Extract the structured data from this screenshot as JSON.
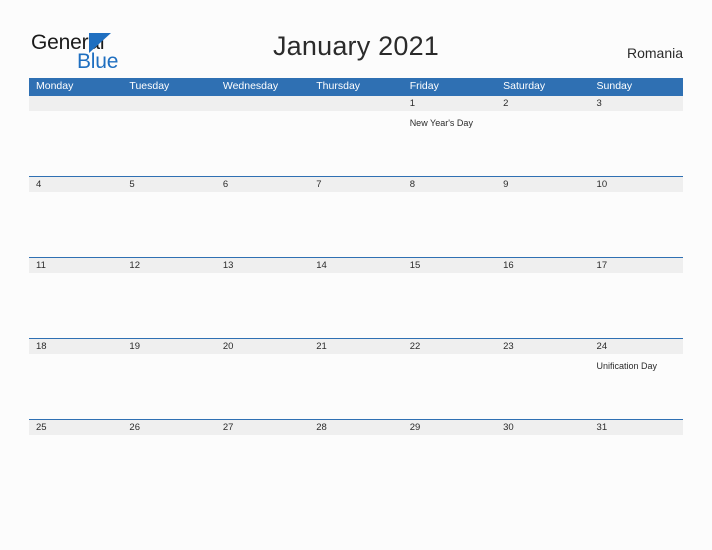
{
  "brand": {
    "word_one": "General",
    "word_two": "Blue",
    "triangle_icon": "triangle-right-icon",
    "accent_color": "#1f6fc0"
  },
  "header": {
    "title": "January 2021",
    "country": "Romania"
  },
  "colors": {
    "header_blue": "#2f70b3",
    "date_band": "#efefef",
    "page_background": "#fcfcfc",
    "text": "#2b2b2b"
  },
  "calendar": {
    "day_names": [
      "Monday",
      "Tuesday",
      "Wednesday",
      "Thursday",
      "Friday",
      "Saturday",
      "Sunday"
    ],
    "weeks": [
      {
        "days": [
          {
            "date": "",
            "events": []
          },
          {
            "date": "",
            "events": []
          },
          {
            "date": "",
            "events": []
          },
          {
            "date": "",
            "events": []
          },
          {
            "date": "1",
            "events": [
              "New Year's Day"
            ]
          },
          {
            "date": "2",
            "events": []
          },
          {
            "date": "3",
            "events": []
          }
        ]
      },
      {
        "days": [
          {
            "date": "4",
            "events": []
          },
          {
            "date": "5",
            "events": []
          },
          {
            "date": "6",
            "events": []
          },
          {
            "date": "7",
            "events": []
          },
          {
            "date": "8",
            "events": []
          },
          {
            "date": "9",
            "events": []
          },
          {
            "date": "10",
            "events": []
          }
        ]
      },
      {
        "days": [
          {
            "date": "11",
            "events": []
          },
          {
            "date": "12",
            "events": []
          },
          {
            "date": "13",
            "events": []
          },
          {
            "date": "14",
            "events": []
          },
          {
            "date": "15",
            "events": []
          },
          {
            "date": "16",
            "events": []
          },
          {
            "date": "17",
            "events": []
          }
        ]
      },
      {
        "days": [
          {
            "date": "18",
            "events": []
          },
          {
            "date": "19",
            "events": []
          },
          {
            "date": "20",
            "events": []
          },
          {
            "date": "21",
            "events": []
          },
          {
            "date": "22",
            "events": []
          },
          {
            "date": "23",
            "events": []
          },
          {
            "date": "24",
            "events": [
              "Unification Day"
            ]
          }
        ]
      },
      {
        "days": [
          {
            "date": "25",
            "events": []
          },
          {
            "date": "26",
            "events": []
          },
          {
            "date": "27",
            "events": []
          },
          {
            "date": "28",
            "events": []
          },
          {
            "date": "29",
            "events": []
          },
          {
            "date": "30",
            "events": []
          },
          {
            "date": "31",
            "events": []
          }
        ]
      }
    ]
  }
}
